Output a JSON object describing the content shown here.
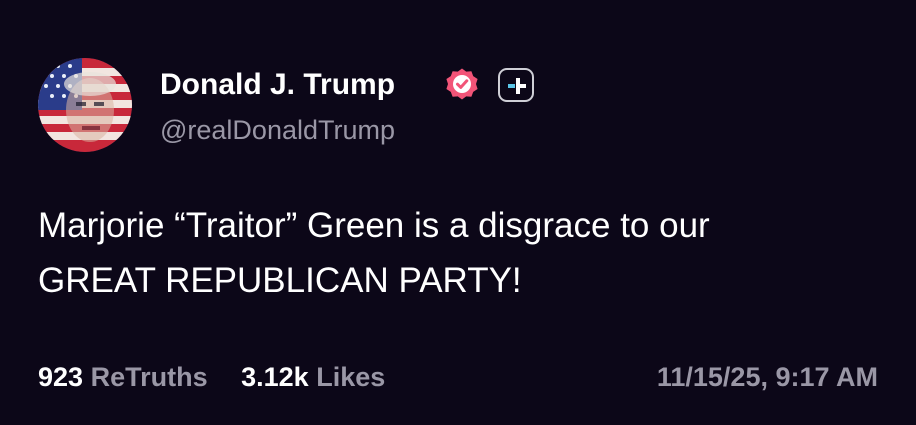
{
  "author": {
    "display_name": "Donald J. Trump",
    "handle": "@realDonaldTrump",
    "avatar_icon": "flag-face-avatar",
    "verified_icon": "verified-badge-icon",
    "plus_icon": "plus-badge-icon"
  },
  "post": {
    "lines": [
      "Marjorie “Traitor” Green is a disgrace to our",
      "GREAT REPUBLICAN PARTY!"
    ]
  },
  "stats": {
    "retruths_count": "923",
    "retruths_label": "ReTruths",
    "likes_count": "3.12k",
    "likes_label": "Likes"
  },
  "timestamp": "11/15/25, 9:17 AM",
  "colors": {
    "background": "#0c0718",
    "text_primary": "#ffffff",
    "text_secondary": "#9a97a6",
    "verified": "#f25478",
    "plus_accent": "#5bc6e8"
  }
}
